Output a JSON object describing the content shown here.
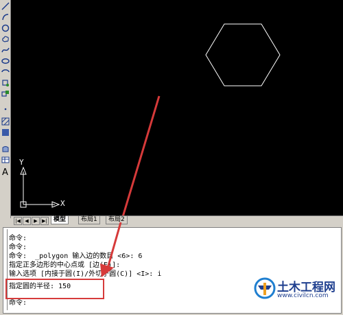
{
  "toolbar": {
    "items": [
      "line-icon",
      "arc-icon",
      "circle-icon",
      "revcloud-icon",
      "spline-icon",
      "ellipse-icon",
      "ellipse-arc-icon",
      "insert-block-icon",
      "make-block-icon",
      "point-icon",
      "hatch-icon",
      "gradient-icon",
      "region-icon",
      "table-icon"
    ],
    "text_tool": "A"
  },
  "canvas": {
    "ucs_y": "Y",
    "ucs_x": "X",
    "polygon_color": "#ffffff",
    "background": "#000000"
  },
  "tabs": {
    "nav": [
      "|◀",
      "◀",
      "▶",
      "▶|"
    ],
    "items": [
      "模型",
      "布局1",
      "布局2"
    ],
    "active": "模型"
  },
  "command_window": {
    "lines": [
      "命令:",
      "命令:",
      "命令:  _polygon 输入边的数目 <6>: 6",
      "指定正多边形的中心点或 [边(E)]:",
      "输入选项 [内接于圆(I)/外切于圆(C)] <I>: i",
      "指定圆的半径: 150"
    ],
    "prompt": "命令:"
  },
  "annotation": {
    "color": "#d63a3a"
  },
  "watermark": {
    "title": "土木工程网",
    "url": "www.civilcn.com"
  }
}
